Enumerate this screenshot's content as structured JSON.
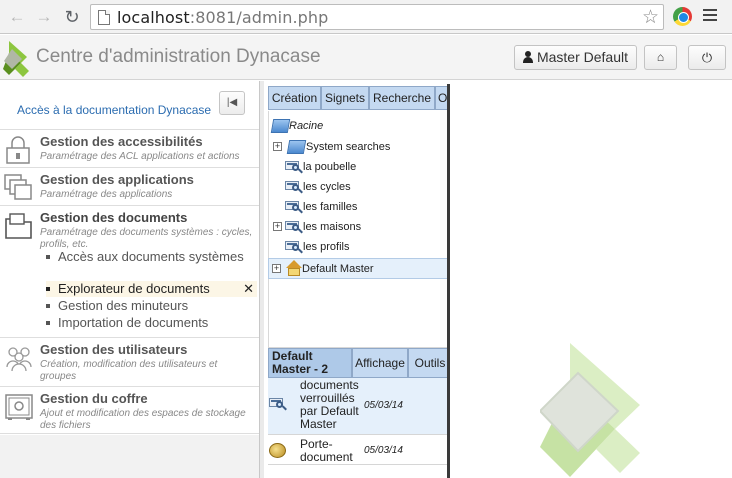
{
  "browser": {
    "back_icon": "arrow-left-icon",
    "forward_icon": "arrow-right-icon",
    "reload_icon": "reload-icon",
    "url_host": "localhost",
    "url_rest": ":8081/admin.php",
    "star_icon": "star-icon",
    "menu_icon": "hamburger-menu-icon"
  },
  "header": {
    "title": "Centre d'administration Dynacase",
    "user_label": "Master Default",
    "home_icon": "home-icon",
    "power_icon": "power-icon"
  },
  "sidebar": {
    "doc_link": "Accès à la documentation Dynacase",
    "collapse_icon": "collapse-left-icon",
    "sections": [
      {
        "title": "Gestion des accessibilités",
        "desc": "Paramétrage des ACL applications et actions"
      },
      {
        "title": "Gestion des applications",
        "desc": "Paramétrage des applications"
      },
      {
        "title": "Gestion des documents",
        "desc": "Paramétrage des documents systèmes : cycles, profils, etc.",
        "items": [
          {
            "label": "Accès aux documents systèmes"
          },
          {
            "label": "Explorateur de documents",
            "active": true,
            "close": "✕"
          },
          {
            "label": "Gestion des minuteurs"
          },
          {
            "label": "Importation de documents"
          }
        ]
      },
      {
        "title": "Gestion des utilisateurs",
        "desc": "Création, modification des utilisateurs et groupes"
      },
      {
        "title": "Gestion du coffre",
        "desc": "Ajout et modification des espaces de stockage des fichiers"
      }
    ]
  },
  "explorer": {
    "tabs": [
      "Création",
      "Signets",
      "Recherche",
      "Outils"
    ],
    "tree": {
      "root": "Racine",
      "system_searches": "System searches",
      "searches": [
        "la poubelle",
        "les cycles",
        "les familles",
        "les maisons",
        "les profils"
      ],
      "default_master": "Default Master"
    },
    "list": {
      "header_name": "Default Master - 2",
      "header_display": "Affichage",
      "header_tools": "Outils",
      "rows": [
        {
          "title": "documents verrouillés par Default Master",
          "date": "05/03/14"
        },
        {
          "title": "Porte-document",
          "date": "05/03/14"
        }
      ]
    }
  },
  "colors": {
    "tab_bg": "#c4d9f1",
    "link": "#2b6cb0",
    "logo_green": "#8dc63f"
  }
}
